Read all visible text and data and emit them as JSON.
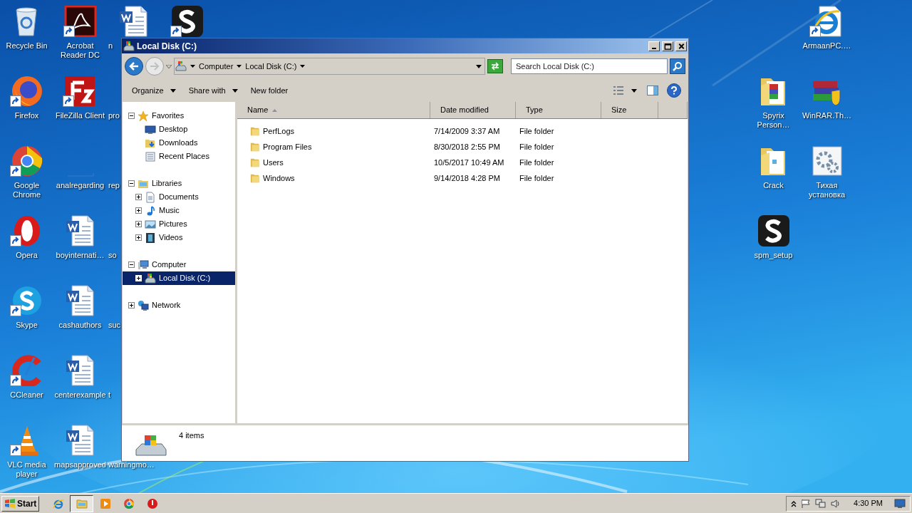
{
  "desktop": {
    "left_columns": [
      [
        {
          "kind": "recycle_bin",
          "label": "Recycle Bin",
          "shortcut": false
        },
        {
          "kind": "firefox",
          "label": "Firefox",
          "shortcut": true
        },
        {
          "kind": "chrome",
          "label": "Google Chrome",
          "shortcut": true
        },
        {
          "kind": "opera",
          "label": "Opera",
          "shortcut": true
        },
        {
          "kind": "skype",
          "label": "Skype",
          "shortcut": true
        },
        {
          "kind": "ccleaner",
          "label": "CCleaner",
          "shortcut": true
        },
        {
          "kind": "vlc",
          "label": "VLC media player",
          "shortcut": true
        }
      ],
      [
        {
          "kind": "acrobat",
          "label": "Acrobat Reader DC",
          "shortcut": true
        },
        {
          "kind": "filezilla",
          "label": "FileZilla Client",
          "shortcut": true
        },
        {
          "kind": "blank",
          "label": "analregarding",
          "shortcut": false
        },
        {
          "kind": "word",
          "label": "boyinternati…",
          "shortcut": false
        },
        {
          "kind": "word",
          "label": "cashauthors",
          "shortcut": false
        },
        {
          "kind": "word",
          "label": "centerexample",
          "shortcut": false
        },
        {
          "kind": "word",
          "label": "mapsapproved",
          "shortcut": false
        }
      ],
      [
        {
          "kind": "word",
          "label": "n",
          "shortcut": false
        },
        {
          "kind": "hidden",
          "label": "pro",
          "shortcut": false
        },
        {
          "kind": "hidden",
          "label": "rep",
          "shortcut": false
        },
        {
          "kind": "hidden",
          "label": "so",
          "shortcut": false
        },
        {
          "kind": "hidden",
          "label": "suc",
          "shortcut": false
        },
        {
          "kind": "hidden",
          "label": "t",
          "shortcut": false
        },
        {
          "kind": "hidden",
          "label": "warningmo…",
          "shortcut": false
        }
      ],
      [
        {
          "kind": "s_app",
          "shortcut": true
        }
      ]
    ],
    "right_columns": [
      [
        {
          "kind": "empty"
        },
        {
          "kind": "folder_archive",
          "label": "Spyrix Person…",
          "shortcut": false
        },
        {
          "kind": "folder",
          "label": "Crack",
          "shortcut": false
        },
        {
          "kind": "s_app",
          "label": "spm_setup",
          "shortcut": false
        }
      ],
      [
        {
          "kind": "ie_doc",
          "label": "ArmaanPC.…",
          "shortcut": true
        },
        {
          "kind": "winrar",
          "label": "WinRAR.Th…",
          "shortcut": false
        },
        {
          "kind": "installer",
          "label": "Тихая установка",
          "shortcut": false
        }
      ]
    ]
  },
  "window": {
    "title": "Local Disk (C:)",
    "breadcrumbs": [
      "Computer",
      "Local Disk (C:)"
    ],
    "search": {
      "placeholder": "Search Local Disk (C:)"
    },
    "toolbar": [
      {
        "label": "Organize",
        "dropdown": true
      },
      {
        "label": "Share with",
        "dropdown": true
      },
      {
        "label": "New folder",
        "dropdown": false
      }
    ],
    "nav_tree": [
      {
        "label": "Favorites",
        "expanded": true,
        "selected": false,
        "children": [
          {
            "label": "Desktop",
            "selected": false
          },
          {
            "label": "Downloads",
            "selected": false
          },
          {
            "label": "Recent Places",
            "selected": false
          }
        ]
      },
      {
        "label": "Libraries",
        "expanded": true,
        "selected": false,
        "children": [
          {
            "label": "Documents",
            "expanded": false,
            "selected": false
          },
          {
            "label": "Music",
            "expanded": false,
            "selected": false
          },
          {
            "label": "Pictures",
            "expanded": false,
            "selected": false
          },
          {
            "label": "Videos",
            "expanded": false,
            "selected": false
          }
        ]
      },
      {
        "label": "Computer",
        "expanded": true,
        "selected": false,
        "children": [
          {
            "label": "Local Disk (C:)",
            "expanded": false,
            "selected": true
          }
        ]
      },
      {
        "label": "Network",
        "expanded": false,
        "selected": false
      }
    ],
    "columns": [
      {
        "label": "Name",
        "sorted": true
      },
      {
        "label": "Date modified",
        "sorted": false
      },
      {
        "label": "Type",
        "sorted": false
      },
      {
        "label": "Size",
        "sorted": false
      }
    ],
    "files": [
      {
        "name": "PerfLogs",
        "date_modified": "7/14/2009 3:37 AM",
        "type": "File folder"
      },
      {
        "name": "Program Files",
        "date_modified": "8/30/2018 2:55 PM",
        "type": "File folder"
      },
      {
        "name": "Users",
        "date_modified": "10/5/2017 10:49 AM",
        "type": "File folder"
      },
      {
        "name": "Windows",
        "date_modified": "9/14/2018 4:28 PM",
        "type": "File folder"
      }
    ],
    "details": {
      "count": "4 items"
    }
  },
  "taskbar": {
    "start": "Start",
    "apps": [
      {
        "kind": "ie",
        "active": false
      },
      {
        "kind": "explorer",
        "active": true
      },
      {
        "kind": "media_player",
        "active": false
      },
      {
        "kind": "chrome",
        "active": false
      },
      {
        "kind": "red_app",
        "active": false
      }
    ],
    "clock": "4:30 PM"
  }
}
